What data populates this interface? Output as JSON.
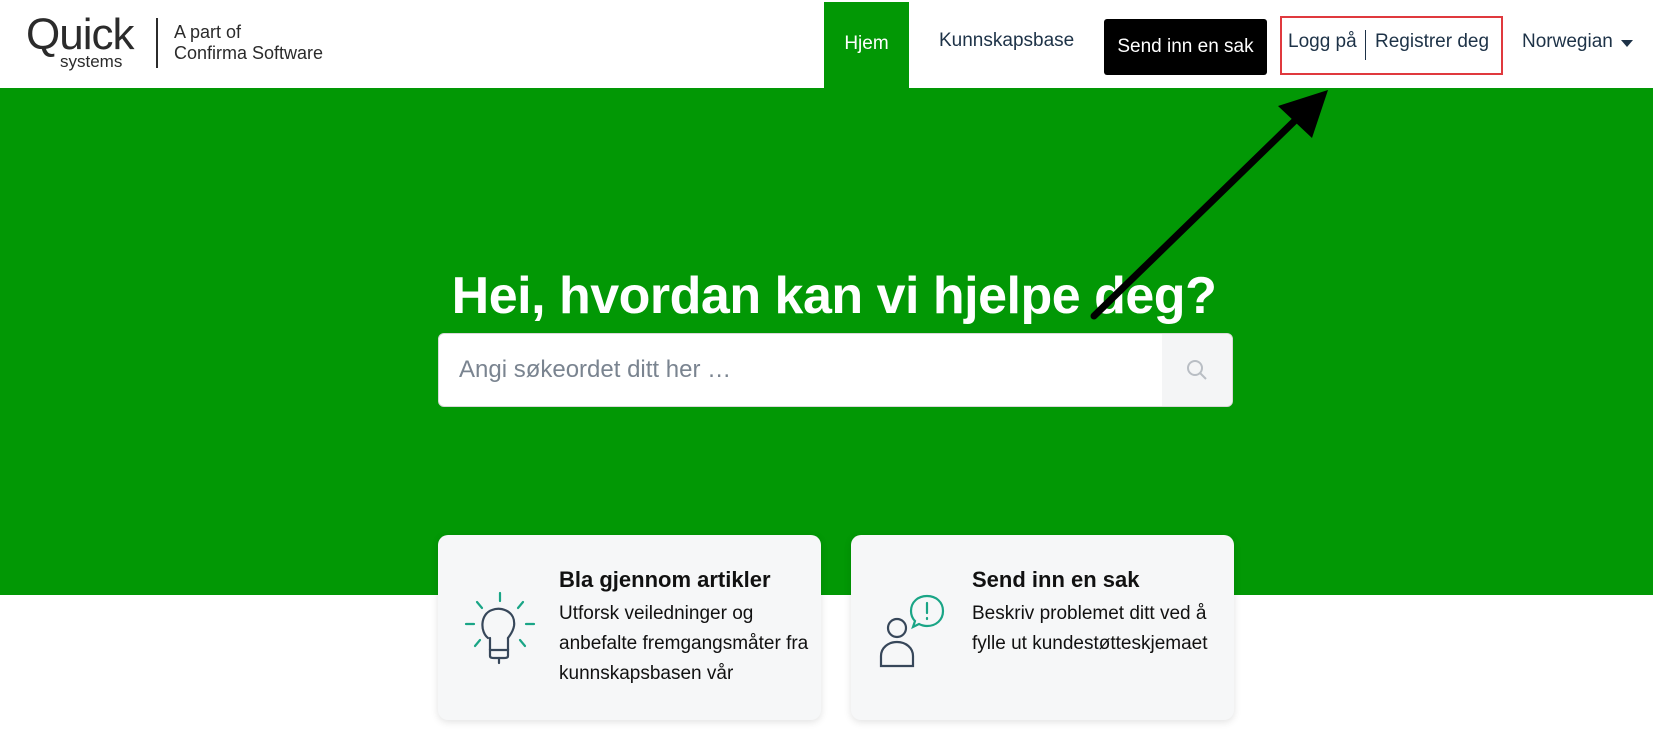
{
  "header": {
    "logo": {
      "word": "Quick",
      "sub": "systems",
      "tagline_1": "A part of",
      "tagline_2": "Confirma Software"
    },
    "nav": {
      "home": "Hjem",
      "knowledge_base": "Kunnskapsbase",
      "submit_case": "Send inn en sak",
      "login": "Logg på",
      "register": "Registrer deg",
      "language": "Norwegian"
    }
  },
  "hero": {
    "title": "Hei, hvordan kan vi hjelpe deg?",
    "search_placeholder": "Angi søkeordet ditt her …"
  },
  "cards": [
    {
      "icon": "lightbulb-icon",
      "title": "Bla gjennom artikler",
      "description": "Utforsk veiledninger og anbefalte fremgangsmåter fra kunnskapsbasen vår"
    },
    {
      "icon": "user-alert-icon",
      "title": "Send inn en sak",
      "description": "Beskriv problemet ditt ved å fylle ut kundestøtteskjemaet"
    }
  ],
  "colors": {
    "brand_green": "#029805",
    "nav_text": "#1d3247",
    "highlight_red": "#e0393e",
    "icon_teal": "#1aa586"
  }
}
